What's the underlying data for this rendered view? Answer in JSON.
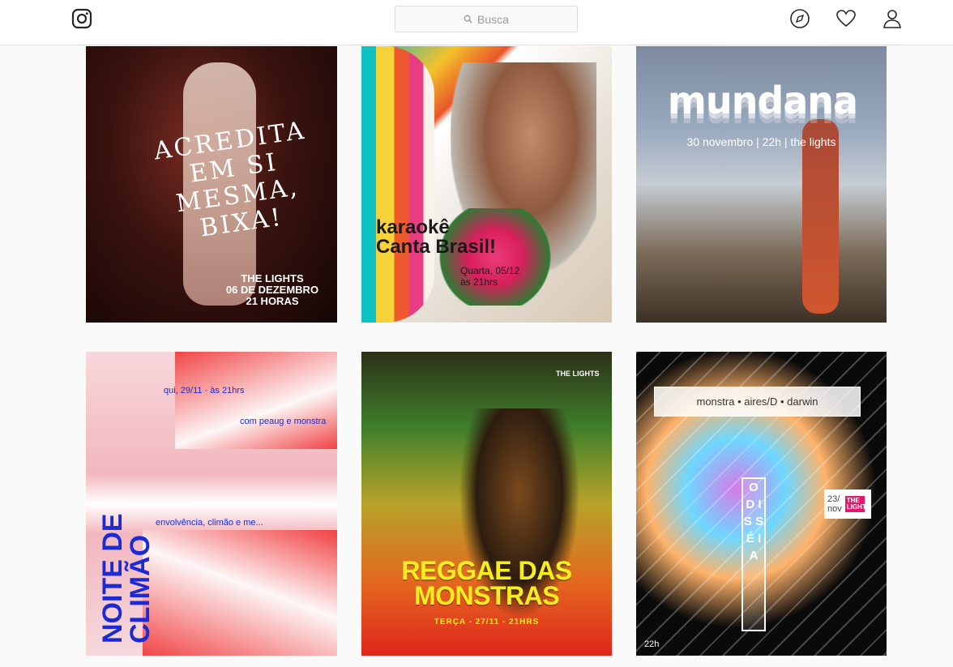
{
  "header": {
    "search_placeholder": "Busca"
  },
  "posts": [
    {
      "title_lines": [
        "ACREDITA",
        "EM SI",
        "MESMA,",
        "BIXA!"
      ],
      "info_lines": [
        "THE LIGHTS",
        "06 DE DEZEMBRO",
        "21 HORAS"
      ]
    },
    {
      "title_lines": [
        "karaokê",
        "Canta Brasil!"
      ],
      "info_lines": [
        "Quarta, 05/12",
        "às 21hrs"
      ]
    },
    {
      "title": "mundana",
      "info": "30 novembro | 22h | the lights"
    },
    {
      "title_lines": [
        "NOITE DE",
        "CLIMÃO"
      ],
      "line1": "qui, 29/11 · às 21hrs",
      "line2": "com peaug e monstra",
      "line3": "envolvência, climão e me..."
    },
    {
      "top": "THE LIGHTS",
      "title_lines": [
        "REGGAE DAS",
        "MONSTRAS"
      ],
      "info": "TERÇA - 27/11 - 21HRS"
    },
    {
      "band": "monstra • aires/D • darwin",
      "odisseia": "O D I S S É I A",
      "date_lines": [
        "23/",
        "nov"
      ],
      "badge": "THE LIGHTS",
      "time": "22h"
    }
  ]
}
